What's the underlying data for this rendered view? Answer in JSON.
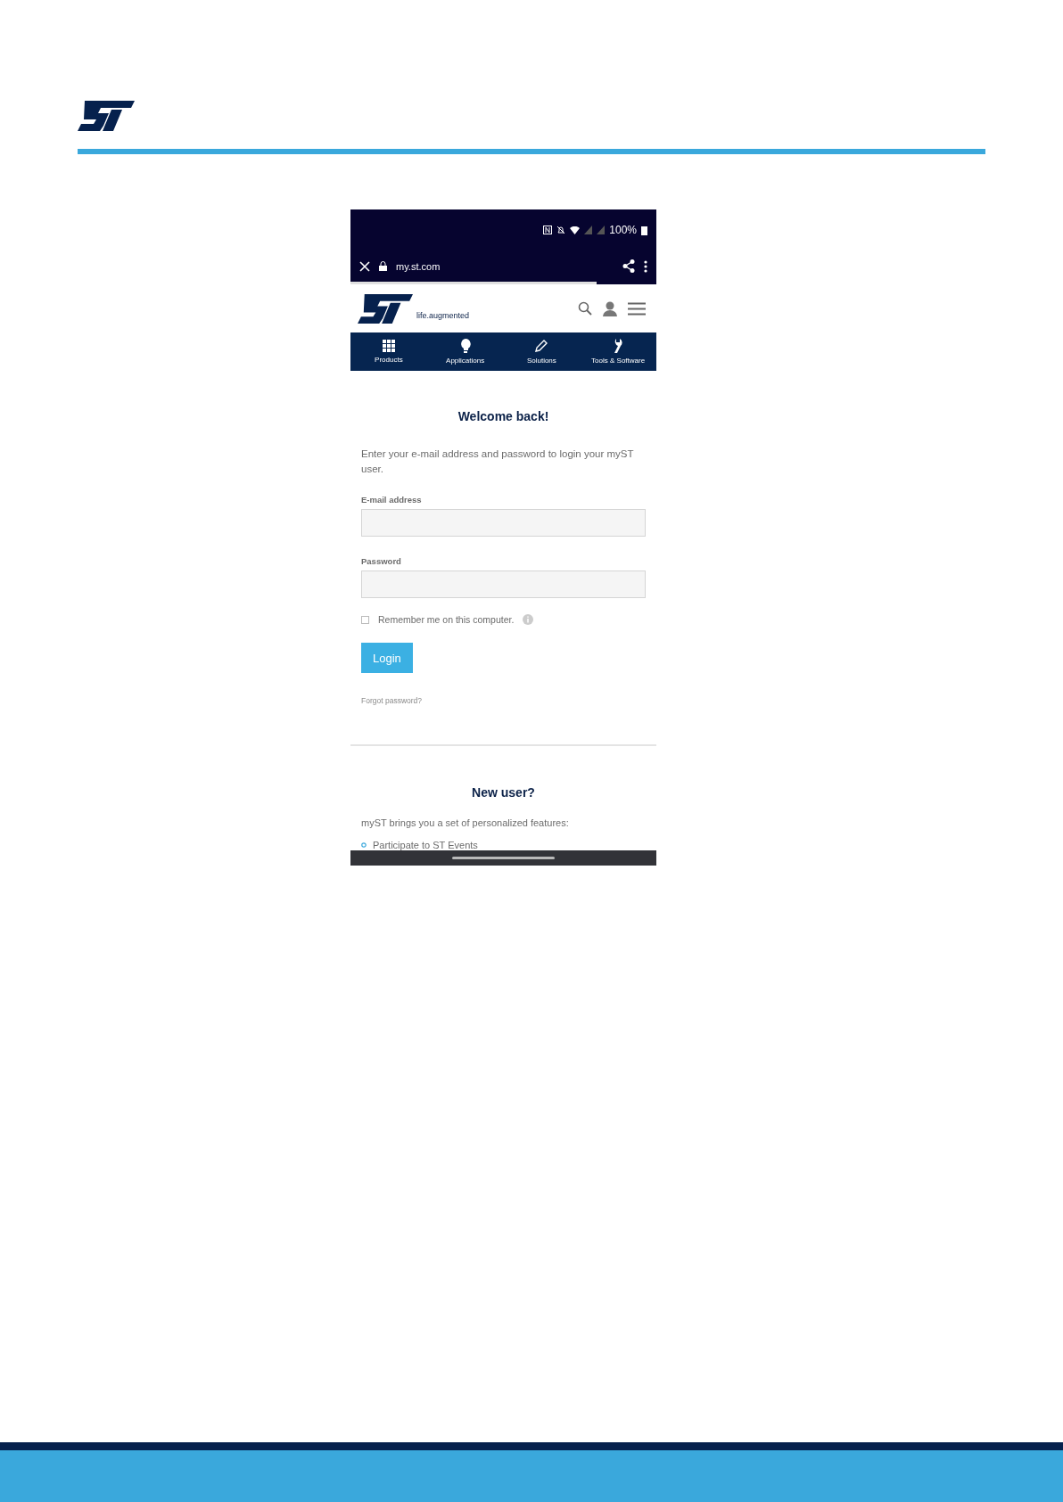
{
  "phone": {
    "status_bar": {
      "battery": "100%"
    },
    "browser_toolbar": {
      "url": "my.st.com"
    },
    "site_header": {
      "tagline": "life.augmented"
    },
    "nav": [
      {
        "label": "Products"
      },
      {
        "label": "Applications"
      },
      {
        "label": "Solutions"
      },
      {
        "label": "Tools & Software"
      }
    ],
    "login": {
      "title": "Welcome back!",
      "intro": "Enter your e-mail address and password to login your myST user.",
      "fields": [
        {
          "label": "E-mail address"
        },
        {
          "label": "Password"
        }
      ],
      "remember": {
        "label": "Remember me on this computer.",
        "checked": false
      },
      "button": "Login",
      "forgot": "Forgot password?"
    },
    "new_user": {
      "title": "New user?",
      "intro": "myST brings you a set of personalized features:",
      "features": [
        "Participate to ST Events"
      ]
    }
  }
}
